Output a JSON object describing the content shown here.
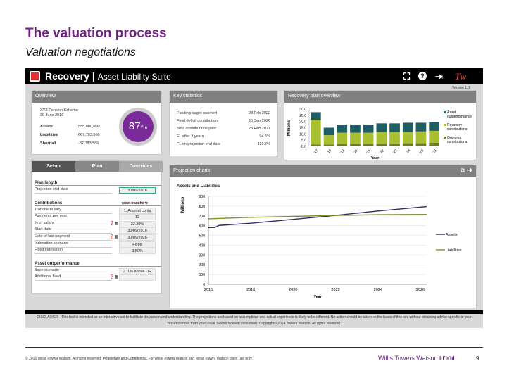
{
  "slide": {
    "title": "The valuation process",
    "subtitle": "Valuation negotiations",
    "footer": "© 2016 Willis Towers Watson. All rights reserved. Proprietary and Confidential. For Willis Towers Watson and Willis Towers Watson client use only.",
    "brand": "Willis Towers Watson",
    "brand_mark": "lıl'lı'lıl",
    "page": "9"
  },
  "app": {
    "name": "Recovery",
    "suite": "Asset Liability Suite",
    "version": "Version 1.0",
    "icons": [
      "fullscreen-icon",
      "help-icon",
      "exit-icon",
      "tw-logo-icon"
    ],
    "disclaimer": "DISCLAIMER - This tool is intended as an interactive aid to facilitate discussion and understanding. The projections are based on assumptions and actual experience is likely to be different. No action should be taken on the basis of this tool without obtaining advice specific to your circumstances from your usual Towers Watson consultant. Copyright© 2014 Towers Watson. All rights reserved."
  },
  "overview": {
    "header": "Overview",
    "scheme": "XYZ Pension Scheme",
    "date": "30 June 2016",
    "rows": [
      {
        "label": "Assets",
        "value": "585,000,000"
      },
      {
        "label": "Liabilities",
        "value": "667,783,566"
      },
      {
        "label": "Shortfall",
        "value": "-82,783,566"
      }
    ],
    "funding_int": "87",
    "funding_dec": ".6",
    "funding_unit": "%",
    "funding_level": 87.6,
    "accent": "#7b2a9a"
  },
  "key_stats": {
    "header": "Key statistics",
    "rows": [
      {
        "label": "Funding target reached",
        "value": "28 Feb 2022"
      },
      {
        "label": "Final deficit contribution",
        "value": "30 Sep 2026"
      },
      {
        "label": "50% contributions paid",
        "value": "28 Feb 2021"
      },
      {
        "label": "FL after 3 years",
        "value": "94.6%"
      },
      {
        "label": "FL on projection end date",
        "value": "110.7%"
      }
    ]
  },
  "tabs": [
    {
      "label": "Setup"
    },
    {
      "label": "Plan",
      "active": true
    },
    {
      "label": "Overrides"
    }
  ],
  "plan": {
    "plan_length": {
      "title": "Plan length",
      "rows": [
        {
          "label": "Projection end date",
          "value": "30/09/2026"
        }
      ]
    },
    "contributions": {
      "title": "Contributions",
      "reset_label": "reset tranche",
      "rows": [
        {
          "label": "Tranche to vary",
          "value": "1. Accrual conts"
        },
        {
          "label": "Payments per year",
          "value": "12"
        },
        {
          "label": "% of salary",
          "value": "32.30%",
          "icons": true
        },
        {
          "label": "Start date",
          "value": "30/09/2016"
        },
        {
          "label": "Date of last payment",
          "value": "30/09/2026",
          "icons": true
        },
        {
          "label": "Indexation scenario",
          "value": "Fixed"
        },
        {
          "label": "Fixed indexation",
          "value": "3.50%"
        }
      ]
    },
    "asset": {
      "title": "Asset outperformance",
      "rows": [
        {
          "label": "Base scenario",
          "value": "2. 1% above DR"
        },
        {
          "label": "Additional fixed",
          "value": "",
          "icons": true
        }
      ]
    }
  },
  "projection": {
    "header": "Projection charts",
    "icons": [
      "copy-icon",
      "next-arrow-icon"
    ]
  },
  "chart_data": [
    {
      "type": "bar",
      "title": "Recovery plan overview",
      "stacked": true,
      "categories": [
        "'17",
        "'18",
        "'19",
        "'20",
        "'21",
        "'22",
        "'23",
        "'24",
        "'25",
        "'26"
      ],
      "xlabel": "Year",
      "ylabel": "Millions",
      "ylim": [
        0,
        30
      ],
      "yticks": [
        "0.0",
        "5.0",
        "10.0",
        "15.0",
        "20.0",
        "25.0",
        "30.0"
      ],
      "legend": "right",
      "series": [
        {
          "name": "Ongoing contributions",
          "color": "#6b7f2a",
          "values": [
            1.5,
            1.5,
            2,
            2,
            2,
            2,
            2,
            2.5,
            2.5,
            3
          ]
        },
        {
          "name": "Recovery contributions",
          "color": "#a8c030",
          "values": [
            20,
            7.5,
            9,
            9,
            9,
            9.5,
            9.5,
            9,
            9.5,
            9.5
          ]
        },
        {
          "name": "Asset outperformance",
          "color": "#1e5c66",
          "values": [
            6,
            6,
            6.5,
            6.5,
            6.5,
            7,
            7,
            7.5,
            7,
            7
          ]
        }
      ]
    },
    {
      "type": "line",
      "title": "Assets and Liabilities",
      "xlabel": "Year",
      "ylabel": "Millions",
      "xlim": [
        2016,
        2026.3
      ],
      "ylim": [
        0,
        900
      ],
      "xticks": [
        "2016",
        "2018",
        "2020",
        "2022",
        "2024",
        "2026"
      ],
      "yticks": [
        "0",
        "100",
        "200",
        "300",
        "400",
        "500",
        "600",
        "700",
        "800",
        "900"
      ],
      "grid": true,
      "legend": "right",
      "series": [
        {
          "name": "Assets",
          "color": "#2e2d5e",
          "x": [
            2016,
            2016.3,
            2016.5,
            2018,
            2020,
            2022,
            2024,
            2026.3
          ],
          "y": [
            580,
            582,
            603,
            625,
            665,
            705,
            750,
            795
          ]
        },
        {
          "name": "Liabilities",
          "color": "#7a8f2a",
          "x": [
            2016,
            2018,
            2020,
            2022,
            2024,
            2026.3
          ],
          "y": [
            670,
            685,
            695,
            705,
            712,
            715
          ]
        }
      ]
    }
  ]
}
